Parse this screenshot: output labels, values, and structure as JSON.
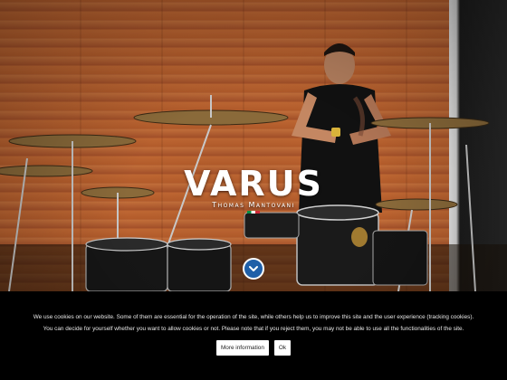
{
  "hero": {
    "title": "VARUS",
    "subtitle": "Thomas Mantovani",
    "scroll_icon": "chevron-down-icon"
  },
  "cookie_banner": {
    "text_line1": "We use cookies on our website. Some of them are essential for the operation of the site, while others help us to improve this site and the user experience (tracking cookies).",
    "text_line2": "You can decide for yourself whether you want to allow cookies or not. Please note that if you reject them, you may not be able to use all the functionalities of the site.",
    "more_info_label": "More information",
    "ok_label": "Ok"
  },
  "colors": {
    "wood_wall": "#b45c2e",
    "scroll_button": "#1f5fa8",
    "banner_bg": "#000000",
    "button_bg": "#ffffff"
  }
}
